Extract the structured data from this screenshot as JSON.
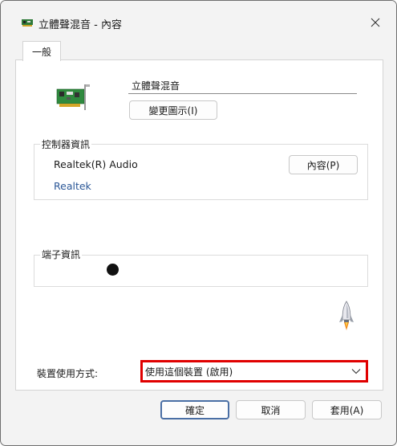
{
  "window": {
    "title": "立體聲混音 - 內容"
  },
  "tabs": [
    {
      "label": "一般",
      "selected": true
    }
  ],
  "general": {
    "device_name_value": "立體聲混音",
    "change_icon_label": "變更圖示(I)",
    "controller": {
      "group_label": "控制器資訊",
      "name": "Realtek(R) Audio",
      "properties_label": "內容(P)",
      "vendor": "Realtek"
    },
    "jack": {
      "group_label": "端子資訊"
    },
    "usage": {
      "label": "裝置使用方式:",
      "selected": "使用這個裝置 (啟用)"
    }
  },
  "footer": {
    "ok_label": "確定",
    "cancel_label": "取消",
    "apply_label": "套用(A)"
  },
  "colors": {
    "highlight_border": "#e00000",
    "link": "#2b5797"
  }
}
